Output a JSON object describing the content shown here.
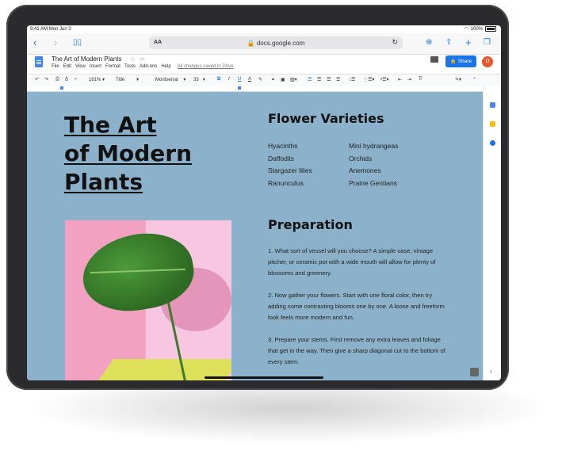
{
  "status": {
    "time": "9:41 AM",
    "date": "Mon Jun 3",
    "battery": "100%"
  },
  "browser": {
    "url": "docs.google.com",
    "aa": "AA"
  },
  "doc": {
    "title": "The Art of Modern Plants",
    "menus": [
      "File",
      "Edit",
      "View",
      "Insert",
      "Format",
      "Tools",
      "Add-ons",
      "Help"
    ],
    "saved_status": "All changes saved in Drive",
    "share_label": "Share",
    "avatar_letter": "D"
  },
  "toolbar": {
    "zoom": "161%",
    "style": "Title",
    "font": "Montserrat",
    "size": "33",
    "bold": "B",
    "italic": "I",
    "underline": "U",
    "text_color": "A"
  },
  "content": {
    "big_title": [
      "The Art",
      "of Modern",
      "Plants"
    ],
    "varieties_heading": "Flower Varieties",
    "varieties_col1": [
      "Hyacinths",
      "Daffodils",
      "Stargazer lilies",
      "Ranunculus"
    ],
    "varieties_col2": [
      "Mini hydrangeas",
      "Orchids",
      "Anemones",
      "Prairie Gentians"
    ],
    "prep_heading": "Preparation",
    "prep_steps": [
      "1. What sort of vessel will you choose? A simple vase, vintage pitcher, or ceramic pot with a wide mouth will allow for plenty of blossoms and greenery.",
      "2. Now gather your flowers. Start with one floral color, then try adding some contrasting blooms one by one. A loose and freeform look feels more modern and fun.",
      "3. Prepare your stems. First remove any extra leaves and foliage that get in the way. Then give a sharp diagonal cut to the bottom of every stem."
    ]
  },
  "colors": {
    "page_bg": "#8bb2ca",
    "accent": "#1a73e8",
    "avatar": "#e8572a"
  }
}
